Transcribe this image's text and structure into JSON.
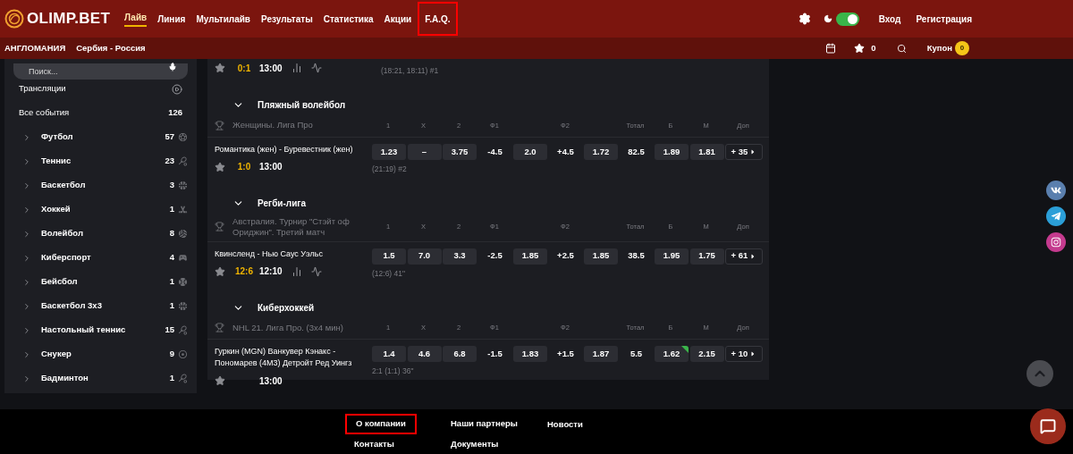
{
  "header": {
    "logo": "OLIMP.BET",
    "nav": [
      {
        "label": "Лайв",
        "selected": true,
        "highlighted": false
      },
      {
        "label": "Линия",
        "selected": false,
        "highlighted": false
      },
      {
        "label": "Мультилайв",
        "selected": false,
        "highlighted": false
      },
      {
        "label": "Результаты",
        "selected": false,
        "highlighted": false
      },
      {
        "label": "Статистика",
        "selected": false,
        "highlighted": false
      },
      {
        "label": "Акции",
        "selected": false,
        "highlighted": false
      },
      {
        "label": "F.A.Q.",
        "selected": false,
        "highlighted": true
      }
    ],
    "theme_toggle": {
      "on": true
    },
    "login": "Вход",
    "register": "Регистрация"
  },
  "subnav": {
    "items": [
      "АНГЛОМАНИЯ",
      "Сербия - Россия"
    ],
    "favorites_count": "0",
    "coupon": {
      "label": "Купон",
      "count": "0"
    }
  },
  "sidebar": {
    "search": {
      "placeholder": "Поиск..."
    },
    "broadcasts": "Трансляции",
    "all_events": {
      "label": "Все события",
      "count": "126"
    },
    "sports": [
      {
        "name": "Футбол",
        "count": "57",
        "kind": "soccer"
      },
      {
        "name": "Теннис",
        "count": "23",
        "kind": "tennis"
      },
      {
        "name": "Баскетбол",
        "count": "3",
        "kind": "basketball"
      },
      {
        "name": "Хоккей",
        "count": "1",
        "kind": "hockey"
      },
      {
        "name": "Волейбол",
        "count": "8",
        "kind": "volleyball"
      },
      {
        "name": "Киберспорт",
        "count": "4",
        "kind": "esports"
      },
      {
        "name": "Бейсбол",
        "count": "1",
        "kind": "baseball"
      },
      {
        "name": "Баскетбол 3х3",
        "count": "1",
        "kind": "basketball"
      },
      {
        "name": "Настольный теннис",
        "count": "15",
        "kind": "table_tennis"
      },
      {
        "name": "Снукер",
        "count": "9",
        "kind": "snooker"
      },
      {
        "name": "Бадминтон",
        "count": "1",
        "kind": "badminton"
      }
    ]
  },
  "top_event": {
    "score": "0:1",
    "time": "13:00",
    "stats": true,
    "info": "(18:21, 18:11) #1"
  },
  "groups": [
    {
      "title": "Пляжный волейбол",
      "league": "Женщины. Лига Про",
      "columns": [
        {
          "label": "1",
          "kind": "single"
        },
        {
          "label": "X",
          "kind": "single"
        },
        {
          "label": "2",
          "kind": "single"
        },
        {
          "label": "Ф1",
          "kind": "handicap"
        },
        {
          "label": "Ф2",
          "kind": "handicap"
        },
        {
          "label": "Тотал",
          "kind": "single"
        },
        {
          "label": "Б",
          "kind": "single"
        },
        {
          "label": "М",
          "kind": "single"
        },
        {
          "label": "Доп",
          "kind": "single"
        }
      ],
      "events": [
        {
          "teams": "Романтика (жен) - Буревестник (жен)",
          "score": "1:0",
          "time": "13:00",
          "stats": false,
          "info": "(21:19) #2",
          "more": "+ 35",
          "odds": [
            {
              "kind": "odd",
              "value": "1.23",
              "rising": false
            },
            {
              "kind": "odd",
              "value": "–",
              "rising": false
            },
            {
              "kind": "odd",
              "value": "3.75",
              "rising": false
            },
            {
              "kind": "line",
              "value": "-4.5"
            },
            {
              "kind": "odd",
              "value": "2.0",
              "rising": false
            },
            {
              "kind": "line",
              "value": "+4.5"
            },
            {
              "kind": "odd",
              "value": "1.72",
              "rising": false
            },
            {
              "kind": "line",
              "value": "82.5"
            },
            {
              "kind": "odd",
              "value": "1.89",
              "rising": false
            },
            {
              "kind": "odd",
              "value": "1.81",
              "rising": false
            }
          ]
        }
      ]
    },
    {
      "title": "Регби-лига",
      "league": "Австралия. Турнир \"Стэйт оф Ориджин\". Третий матч",
      "columns": [
        {
          "label": "1",
          "kind": "single"
        },
        {
          "label": "X",
          "kind": "single"
        },
        {
          "label": "2",
          "kind": "single"
        },
        {
          "label": "Ф1",
          "kind": "handicap"
        },
        {
          "label": "Ф2",
          "kind": "handicap"
        },
        {
          "label": "Тотал",
          "kind": "single"
        },
        {
          "label": "Б",
          "kind": "single"
        },
        {
          "label": "М",
          "kind": "single"
        },
        {
          "label": "Доп",
          "kind": "single"
        }
      ],
      "events": [
        {
          "teams": "Квинсленд - Нью Саус Уэльс",
          "score": "12:6",
          "time": "12:10",
          "stats": true,
          "info": "(12:6) 41\"",
          "more": "+ 61",
          "odds": [
            {
              "kind": "odd",
              "value": "1.5",
              "rising": false
            },
            {
              "kind": "odd",
              "value": "7.0",
              "rising": false
            },
            {
              "kind": "odd",
              "value": "3.3",
              "rising": false
            },
            {
              "kind": "line",
              "value": "-2.5"
            },
            {
              "kind": "odd",
              "value": "1.85",
              "rising": false
            },
            {
              "kind": "line",
              "value": "+2.5"
            },
            {
              "kind": "odd",
              "value": "1.85",
              "rising": false
            },
            {
              "kind": "line",
              "value": "38.5"
            },
            {
              "kind": "odd",
              "value": "1.95",
              "rising": false
            },
            {
              "kind": "odd",
              "value": "1.75",
              "rising": false
            }
          ]
        }
      ]
    },
    {
      "title": "Киберхоккей",
      "league": "NHL 21. Лига Про. (3х4 мин)",
      "columns": [
        {
          "label": "1",
          "kind": "single"
        },
        {
          "label": "X",
          "kind": "single"
        },
        {
          "label": "2",
          "kind": "single"
        },
        {
          "label": "Ф1",
          "kind": "handicap"
        },
        {
          "label": "Ф2",
          "kind": "handicap"
        },
        {
          "label": "Тотал",
          "kind": "single"
        },
        {
          "label": "Б",
          "kind": "single"
        },
        {
          "label": "М",
          "kind": "single"
        },
        {
          "label": "Доп",
          "kind": "single"
        }
      ],
      "events": [
        {
          "teams": "Гуркин (MGN) Ванкувер Кэнакс - Пономарев (4M3) Детройт Ред Уингз",
          "time": "13:00",
          "stats": false,
          "info": "2:1 (1:1) 36\"",
          "more": "+ 10",
          "odds": [
            {
              "kind": "odd",
              "value": "1.4",
              "rising": false
            },
            {
              "kind": "odd",
              "value": "4.6",
              "rising": false
            },
            {
              "kind": "odd",
              "value": "6.8",
              "rising": false
            },
            {
              "kind": "line",
              "value": "-1.5"
            },
            {
              "kind": "odd",
              "value": "1.83",
              "rising": false
            },
            {
              "kind": "line",
              "value": "+1.5"
            },
            {
              "kind": "odd",
              "value": "1.87",
              "rising": false
            },
            {
              "kind": "line",
              "value": "5.5"
            },
            {
              "kind": "odd",
              "value": "1.62",
              "rising": true
            },
            {
              "kind": "odd",
              "value": "2.15",
              "rising": false
            }
          ]
        }
      ]
    }
  ],
  "footer": {
    "columns": [
      [
        {
          "label": "О компании",
          "highlighted": true
        },
        {
          "label": "Контакты",
          "highlighted": false
        }
      ],
      [
        {
          "label": "Наши партнеры",
          "highlighted": false
        },
        {
          "label": "Документы",
          "highlighted": false
        }
      ],
      [
        {
          "label": "Новости",
          "highlighted": false
        }
      ]
    ]
  }
}
